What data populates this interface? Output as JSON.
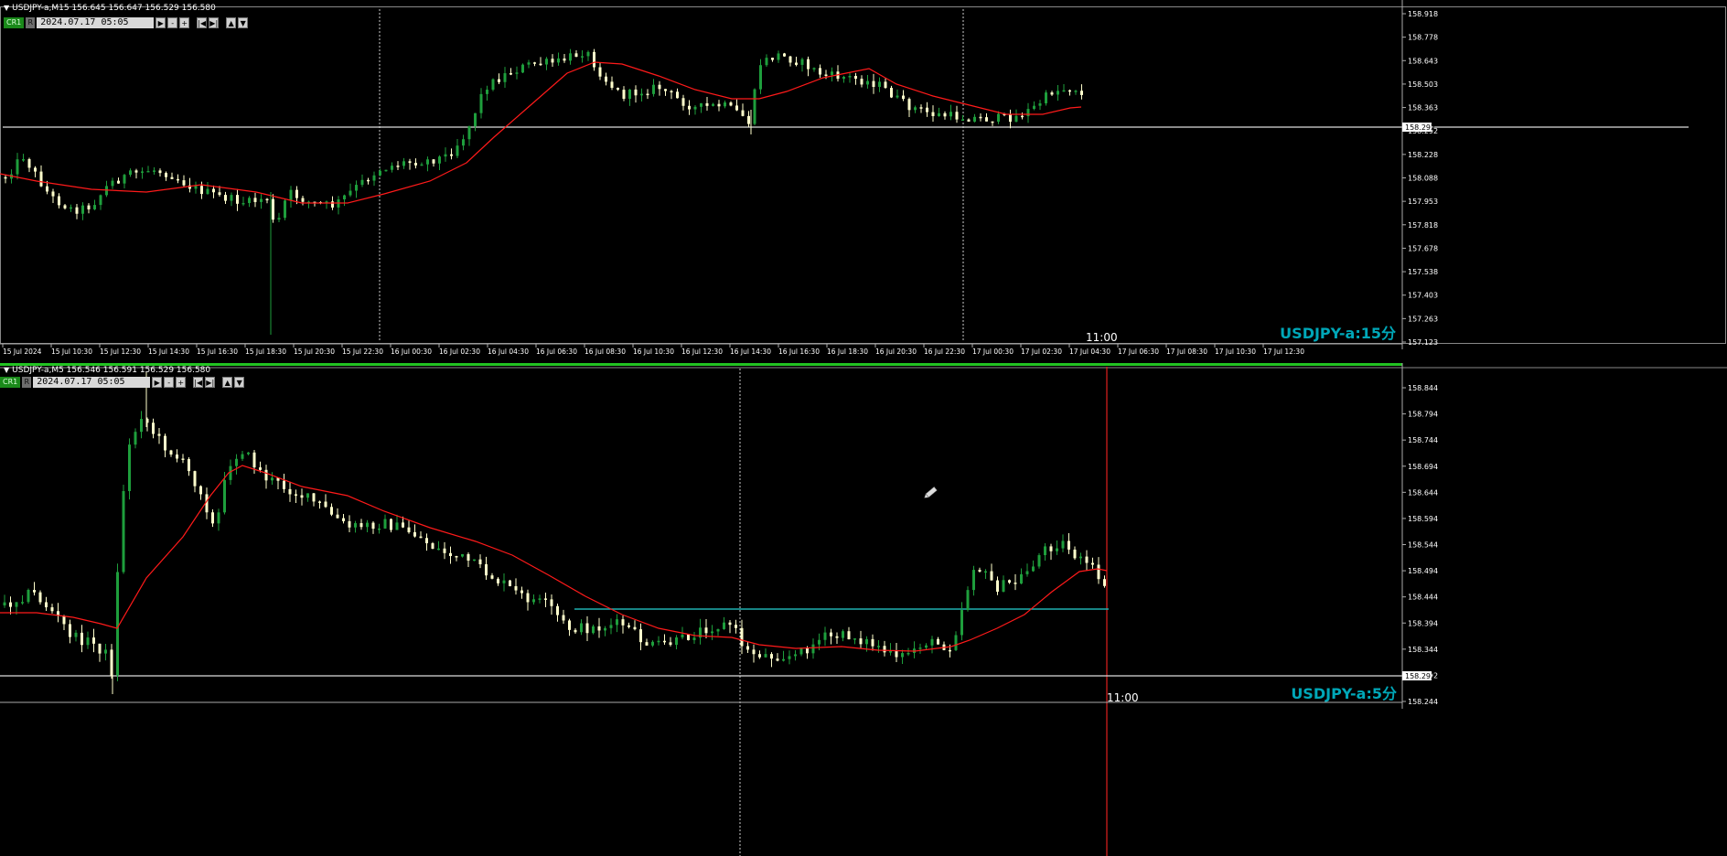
{
  "top_chart": {
    "header": "USDJPY-a,M15  156.645 156.647 156.529 156.580",
    "toolbar": {
      "cr": "CR1",
      "r": "R",
      "date": "2024.07.17 05:05",
      "buttons": [
        "▶",
        "-",
        "+",
        "|◀",
        "▶|",
        "▲",
        "▼"
      ]
    },
    "symbol_label": "USDJPY-a:15分",
    "cursor_time": "11:00",
    "price_levels": [
      "158.918",
      "158.778",
      "158.643",
      "158.503",
      "158.363",
      "158.292",
      "158.228",
      "158.088",
      "157.953",
      "157.818",
      "157.678",
      "157.538",
      "157.403",
      "157.263",
      "157.123"
    ],
    "time_labels": [
      "15 Jul 2024",
      "15 Jul 10:30",
      "15 Jul 12:30",
      "15 Jul 14:30",
      "15 Jul 16:30",
      "15 Jul 18:30",
      "15 Jul 20:30",
      "15 Jul 22:30",
      "16 Jul 00:30",
      "16 Jul 02:30",
      "16 Jul 04:30",
      "16 Jul 06:30",
      "16 Jul 08:30",
      "16 Jul 10:30",
      "16 Jul 12:30",
      "16 Jul 14:30",
      "16 Jul 16:30",
      "16 Jul 18:30",
      "16 Jul 20:30",
      "16 Jul 22:30",
      "17 Jul 00:30",
      "17 Jul 02:30",
      "17 Jul 04:30",
      "17 Jul 06:30",
      "17 Jul 08:30",
      "17 Jul 10:30",
      "17 Jul 12:30"
    ],
    "horizontal_line_price": "158.292"
  },
  "bottom_chart": {
    "header": "USDJPY-a,M5  156.546 156.591 156.529 156.580",
    "toolbar": {
      "cr": "CR1",
      "r": "R",
      "date": "2024.07.17 05:05",
      "buttons": [
        "▶",
        "-",
        "+",
        "|◀",
        "▶|",
        "▲",
        "▼"
      ]
    },
    "symbol_label": "USDJPY-a:5分",
    "cursor_time": "11:00",
    "price_levels": [
      "158.844",
      "158.794",
      "158.744",
      "158.694",
      "158.644",
      "158.594",
      "158.544",
      "158.494",
      "158.444",
      "158.394",
      "158.344",
      "158.292",
      "158.244"
    ],
    "horizontal_line_price": "158.292"
  },
  "colors": {
    "bull": "#1e9e3c",
    "bear": "#ffffcc",
    "ma": "#ff1a1a",
    "level": "#1fb0b0",
    "label": "#00a7b8"
  }
}
